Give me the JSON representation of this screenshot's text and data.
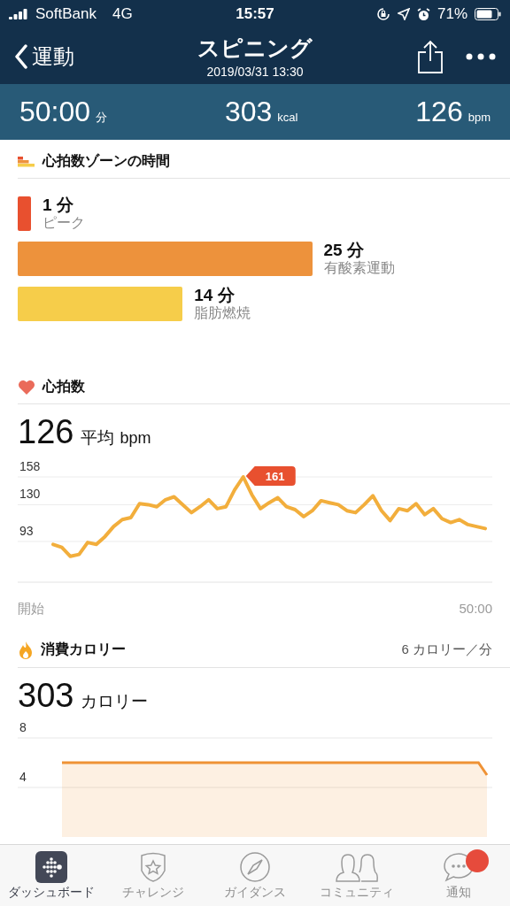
{
  "status_bar": {
    "carrier": "SoftBank",
    "network": "4G",
    "time": "15:57",
    "battery": "71%"
  },
  "nav": {
    "back": "運動",
    "title": "スピニング",
    "subtitle": "2019/03/31 13:30"
  },
  "stats": [
    {
      "value": "50:00",
      "unit": "分"
    },
    {
      "value": "303",
      "unit": "kcal"
    },
    {
      "value": "126",
      "unit": "bpm"
    }
  ],
  "zones_section": {
    "title": "心拍数ゾーンの時間",
    "zones": [
      {
        "minutes": "1 分",
        "name": "ピーク",
        "color": "#e8502f"
      },
      {
        "minutes": "25 分",
        "name": "有酸素運動",
        "color": "#ed923c"
      },
      {
        "minutes": "14 分",
        "name": "脂肪燃焼",
        "color": "#f6cd4a"
      }
    ]
  },
  "heart_section": {
    "title": "心拍数",
    "value": "126",
    "label": "平均",
    "unit": "bpm",
    "axis_labels": [
      "開始",
      "50:00"
    ],
    "chart_data": {
      "type": "line",
      "ylim": [
        52,
        158
      ],
      "yticks": [
        93,
        130,
        158
      ],
      "grid": true,
      "series": [
        {
          "color": "#f2ae3c",
          "values": [
            90,
            87,
            78,
            80,
            92,
            90,
            98,
            108,
            115,
            117,
            131,
            130,
            128,
            135,
            138,
            130,
            122,
            128,
            135,
            126,
            128,
            145,
            158,
            140,
            126,
            132,
            137,
            128,
            125,
            118,
            124,
            134,
            132,
            130,
            124,
            122,
            130,
            139,
            124,
            114,
            126,
            124,
            131,
            120,
            126,
            116,
            112,
            115,
            110,
            108,
            106
          ]
        }
      ],
      "annotations": [
        {
          "text": "161"
        }
      ]
    }
  },
  "calorie_section": {
    "title": "消費カロリー",
    "rate": "6 カロリー／分",
    "value": "303",
    "unit": "カロリー",
    "chart_data": {
      "type": "area",
      "ylim": [
        0,
        8
      ],
      "yticks": [
        4,
        8
      ],
      "grid": true,
      "series": [
        {
          "color": "#ef9235",
          "values": [
            6,
            6,
            6,
            6,
            6,
            6,
            6,
            6,
            6,
            6,
            6,
            6,
            6,
            6,
            6,
            6,
            6,
            6,
            6,
            6,
            6,
            6,
            6,
            6,
            6,
            6,
            6,
            6,
            6,
            6,
            6,
            6,
            6,
            6,
            6,
            6,
            6,
            6,
            6,
            6,
            6,
            6,
            6,
            6,
            6,
            6,
            6,
            6,
            6,
            6,
            5
          ]
        }
      ]
    }
  },
  "tabs": [
    {
      "label": "ダッシュボード",
      "selected": true,
      "badge": false
    },
    {
      "label": "チャレンジ",
      "selected": false,
      "badge": false
    },
    {
      "label": "ガイダンス",
      "selected": false,
      "badge": false
    },
    {
      "label": "コミュニティ",
      "selected": false,
      "badge": false
    },
    {
      "label": "通知",
      "selected": false,
      "badge": true
    }
  ]
}
